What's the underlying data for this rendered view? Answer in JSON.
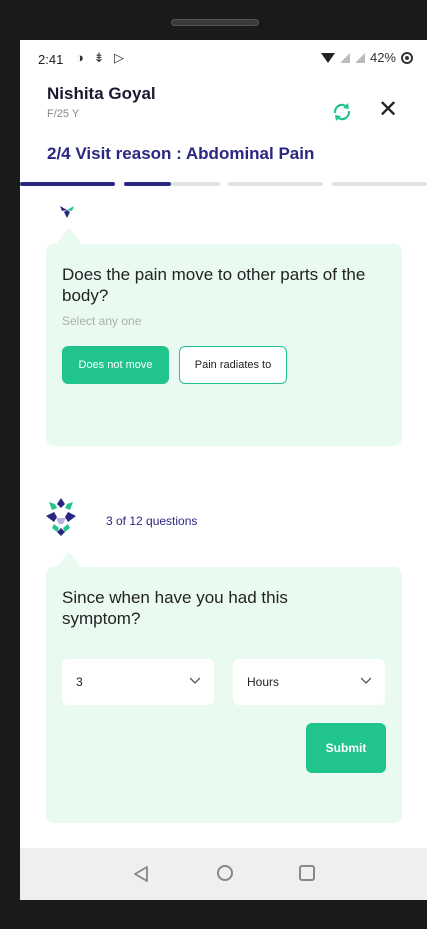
{
  "status_bar": {
    "time": "2:41",
    "left_icons": [
      "notification-icon",
      "cast-icon",
      "play-icon"
    ],
    "battery": "42%"
  },
  "header": {
    "patient_name": "Nishita Goyal",
    "patient_info": "F/25 Y",
    "visit_reason": "2/4 Visit reason : Abdominal Pain",
    "progress_segments": 4,
    "progress_current": 2
  },
  "question_1": {
    "text": "Does the pain move to other parts of the body?",
    "hint": "Select any one",
    "options": [
      "Does not move",
      "Pain radiates to"
    ],
    "selected": "Does not move"
  },
  "question_counter": "3 of 12 questions",
  "question_2": {
    "text": "Since when have you had this symptom?",
    "number_value": "3",
    "unit_value": "Hours",
    "submit_label": "Submit"
  },
  "colors": {
    "accent_green": "#20c48c",
    "brand_purple": "#2a2780",
    "card_bg": "#e9faf1"
  }
}
